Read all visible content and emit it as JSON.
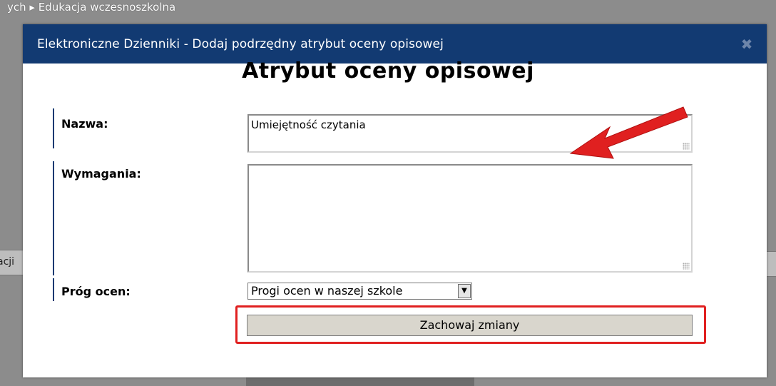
{
  "background": {
    "breadcrumb": "ych ▸ Edukacja wczesnoszkolna",
    "left_tab_text": "acji"
  },
  "modal": {
    "title": "Elektroniczne Dzienniki - Dodaj podrzędny atrybut oceny opisowej",
    "close_symbol": "✖",
    "heading": "Atrybut oceny opisowej"
  },
  "form": {
    "name_label": "Nazwa:",
    "name_value": "Umiejętność czytania",
    "requirements_label": "Wymagania:",
    "requirements_value": "",
    "threshold_label": "Próg ocen:",
    "threshold_selected": "Progi ocen w naszej szkole",
    "save_label": "Zachowaj zmiany"
  },
  "colors": {
    "header": "#123a72",
    "annotation": "#e02020"
  }
}
